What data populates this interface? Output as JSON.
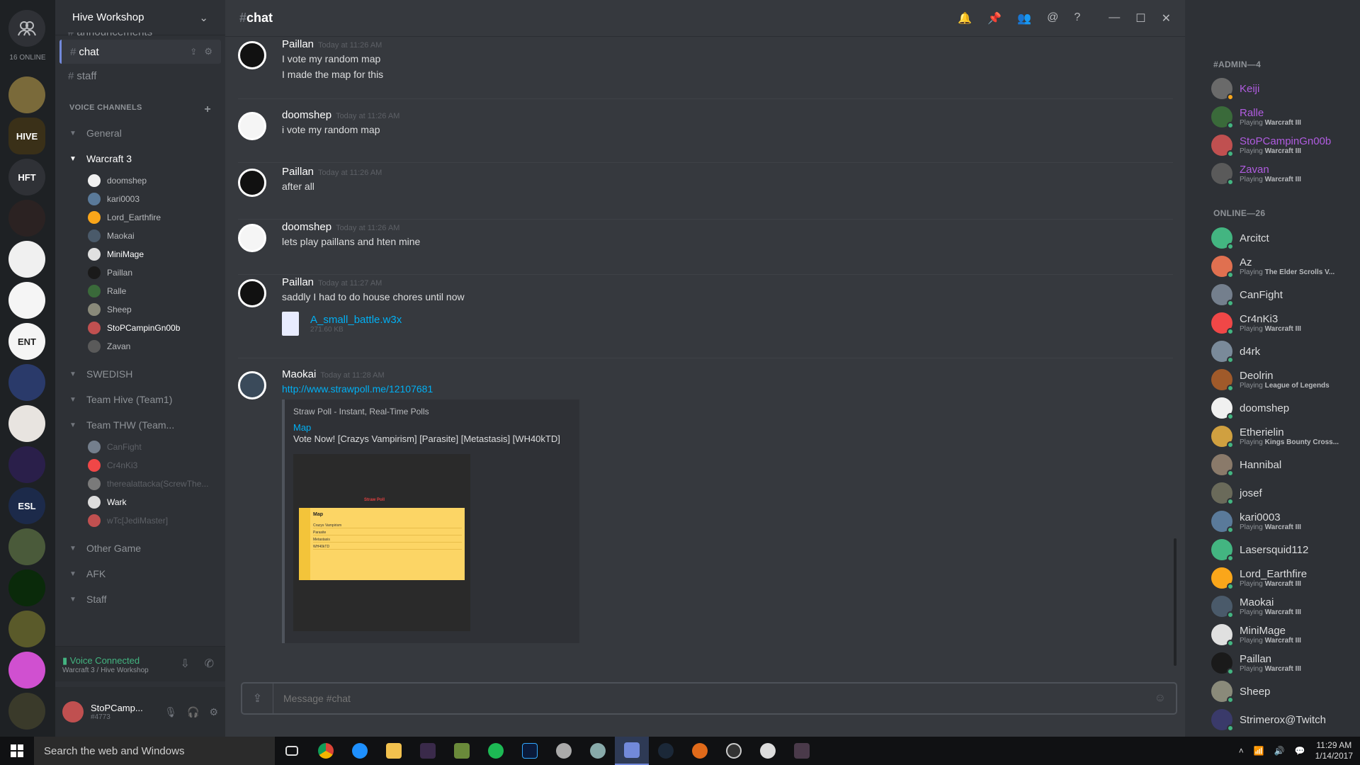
{
  "guilds": {
    "online_count": "16 ONLINE",
    "items": [
      {
        "label": "",
        "color": "#7a6a3a"
      },
      {
        "label": "HIVE",
        "color": "#3a3018"
      },
      {
        "label": "HFT",
        "color": "#2f3136"
      },
      {
        "label": "",
        "color": "#2b2222"
      },
      {
        "label": "",
        "color": "#f0f0f0"
      },
      {
        "label": "",
        "color": "#f5f5f5"
      },
      {
        "label": "ENT",
        "color": "#f5f5f5"
      },
      {
        "label": "",
        "color": "#2a3a6a"
      },
      {
        "label": "",
        "color": "#e8e4e0"
      },
      {
        "label": "",
        "color": "#2a1f4a"
      },
      {
        "label": "ESL",
        "color": "#1c2a4a"
      },
      {
        "label": "",
        "color": "#4a5a3a"
      },
      {
        "label": "",
        "color": "#0a2a0a"
      },
      {
        "label": "",
        "color": "#5a5a2a"
      },
      {
        "label": "",
        "color": "#d050d0"
      },
      {
        "label": "",
        "color": "#3a3a2a"
      }
    ]
  },
  "server": {
    "name": "Hive Workshop"
  },
  "text_channels": [
    {
      "name": "announcements"
    },
    {
      "name": "chat"
    },
    {
      "name": "staff"
    }
  ],
  "voice_header": "VOICE CHANNELS",
  "voice_channels": {
    "general": "General",
    "warcraft3": "Warcraft 3",
    "warcraft3_users": [
      "doomshep",
      "kari0003",
      "Lord_Earthfire",
      "Maokai",
      "MiniMage",
      "Paillan",
      "Ralle",
      "Sheep",
      "StoPCampinGn00b",
      "Zavan"
    ],
    "swedish": "SWEDISH",
    "team_hive": "Team Hive (Team1)",
    "team_thw": "Team THW (Team...",
    "team_thw_users": [
      "CanFight",
      "Cr4nKi3",
      "therealattacka(ScrewThe...",
      "Wark",
      "wTc[JediMaster]"
    ],
    "other_game": "Other Game",
    "afk": "AFK",
    "staff": "Staff"
  },
  "voice_connected": {
    "status": "Voice Connected",
    "location": "Warcraft 3 / Hive Workshop"
  },
  "user": {
    "name": "StoPCamp...",
    "tag": "#4773"
  },
  "chat": {
    "channel": "chat",
    "input_placeholder": "Message #chat"
  },
  "messages": [
    {
      "author": "Paillan",
      "time": "Today at 11:26 AM",
      "lines": [
        "I vote my random map",
        "I made the map for this"
      ]
    },
    {
      "author": "doomshep",
      "time": "Today at 11:26 AM",
      "lines": [
        "i vote my random map"
      ]
    },
    {
      "author": "Paillan",
      "time": "Today at 11:26 AM",
      "lines": [
        "after all"
      ]
    },
    {
      "author": "doomshep",
      "time": "Today at 11:26 AM",
      "lines": [
        "lets play paillans and hten mine"
      ]
    },
    {
      "author": "Paillan",
      "time": "Today at 11:27 AM",
      "lines": [
        "saddly I had to do house chores until now"
      ],
      "file": {
        "name": "A_small_battle.w3x",
        "size": "271.60 KB"
      }
    },
    {
      "author": "Maokai",
      "time": "Today at 11:28 AM",
      "link": "http://www.strawpoll.me/12107681",
      "embed": {
        "provider": "Straw Poll - Instant, Real-Time Polls",
        "title": "Map",
        "description": "Vote Now! [Crazys Vampirism] [Parasite] [Metastasis] [WH40kTD]",
        "image_brand": "Straw Poll",
        "image_title": "Map",
        "image_options": [
          "Crazys Vampirism",
          "Parasite",
          "Metastasis",
          "WH40kTD"
        ]
      }
    }
  ],
  "members": {
    "admin_header": "#ADMIN—4",
    "admins": [
      {
        "name": "Keiji",
        "game": "",
        "color": "#b05ce0",
        "status": "#faa61a",
        "av": "#6a6a6a"
      },
      {
        "name": "Ralle",
        "game": "Warcraft III",
        "color": "#b05ce0",
        "status": "#43b581",
        "av": "#3a6a3a"
      },
      {
        "name": "StoPCampinGn00b",
        "game": "Warcraft III",
        "color": "#b05ce0",
        "status": "#43b581",
        "av": "#c05050"
      },
      {
        "name": "Zavan",
        "game": "Warcraft III",
        "color": "#b05ce0",
        "status": "#43b581",
        "av": "#5a5a5a"
      }
    ],
    "online_header": "ONLINE—26",
    "online": [
      {
        "name": "Arcitct",
        "game": "",
        "status": "#43b581",
        "av": "#43b581"
      },
      {
        "name": "Az",
        "game": "The Elder Scrolls V...",
        "status": "#43b581",
        "av": "#e07050"
      },
      {
        "name": "CanFight",
        "game": "",
        "status": "#43b581",
        "av": "#747f8d"
      },
      {
        "name": "Cr4nKi3",
        "game": "Warcraft III",
        "status": "#43b581",
        "av": "#f04747"
      },
      {
        "name": "d4rk",
        "game": "",
        "status": "#43b581",
        "av": "#7a8a9a"
      },
      {
        "name": "Deolrin",
        "game": "League of Legends",
        "status": "#43b581",
        "av": "#a05a2a"
      },
      {
        "name": "doomshep",
        "game": "",
        "status": "#43b581",
        "av": "#f0f0f0"
      },
      {
        "name": "Etherielin",
        "game": "Kings Bounty Cross...",
        "status": "#43b581",
        "av": "#d0a040"
      },
      {
        "name": "Hannibal",
        "game": "",
        "status": "#43b581",
        "av": "#8a7a6a"
      },
      {
        "name": "josef",
        "game": "",
        "status": "#43b581",
        "av": "#6a6a5a"
      },
      {
        "name": "kari0003",
        "game": "Warcraft III",
        "status": "#43b581",
        "av": "#5a7a9a"
      },
      {
        "name": "Lasersquid112",
        "game": "",
        "status": "#43b581",
        "av": "#43b581"
      },
      {
        "name": "Lord_Earthfire",
        "game": "Warcraft III",
        "status": "#43b581",
        "av": "#faa61a"
      },
      {
        "name": "Maokai",
        "game": "Warcraft III",
        "status": "#43b581",
        "av": "#4a5a6a"
      },
      {
        "name": "MiniMage",
        "game": "Warcraft III",
        "status": "#43b581",
        "av": "#e0e0e0"
      },
      {
        "name": "Paillan",
        "game": "Warcraft III",
        "status": "#43b581",
        "av": "#1a1a1a"
      },
      {
        "name": "Sheep",
        "game": "",
        "status": "#43b581",
        "av": "#8a8a7a"
      },
      {
        "name": "Strimerox@Twitch",
        "game": "",
        "status": "#43b581",
        "av": "#3a3a6a"
      }
    ],
    "playing_prefix": "Playing"
  },
  "taskbar": {
    "search": "Search the web and Windows",
    "time": "11:29 AM",
    "date": "1/14/2017"
  }
}
